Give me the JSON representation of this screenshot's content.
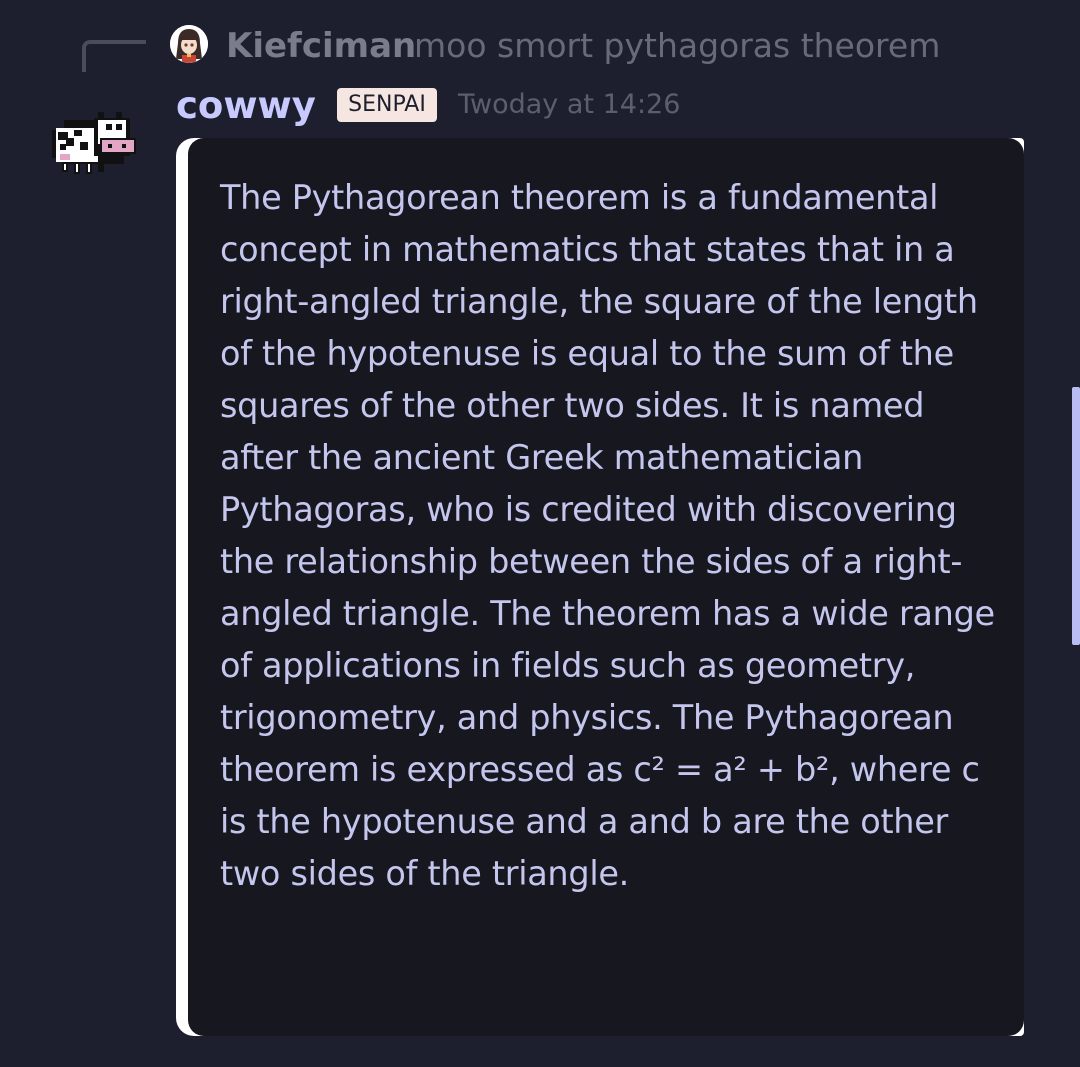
{
  "reply": {
    "author": "Kiefciman",
    "text": "moo smort pythagoras theorem"
  },
  "message": {
    "author": "cowwy",
    "badge": "SENPAI",
    "timestamp": "Twoday at 14:26",
    "body": "The Pythagorean theorem is a fundamental concept in mathematics that states that in a right-angled triangle, the square of the length of the hypotenuse is equal to the sum of the squares of the other two sides. It is named after the ancient Greek mathematician Pythagoras, who is credited with discovering the relationship between the sides of a right-angled triangle. The theorem has a wide range of applications in fields such as geometry, trigonometry, and physics. The Pythagorean theorem is expressed as c² = a² + b², where c is the hypotenuse and a and b are the other two sides of the triangle."
  },
  "colors": {
    "background": "#1e1f2e",
    "bubble": "#16171f",
    "author": "#c8caff",
    "badge": "#f6e6e2",
    "scrollbar": "#b9bdf4"
  }
}
